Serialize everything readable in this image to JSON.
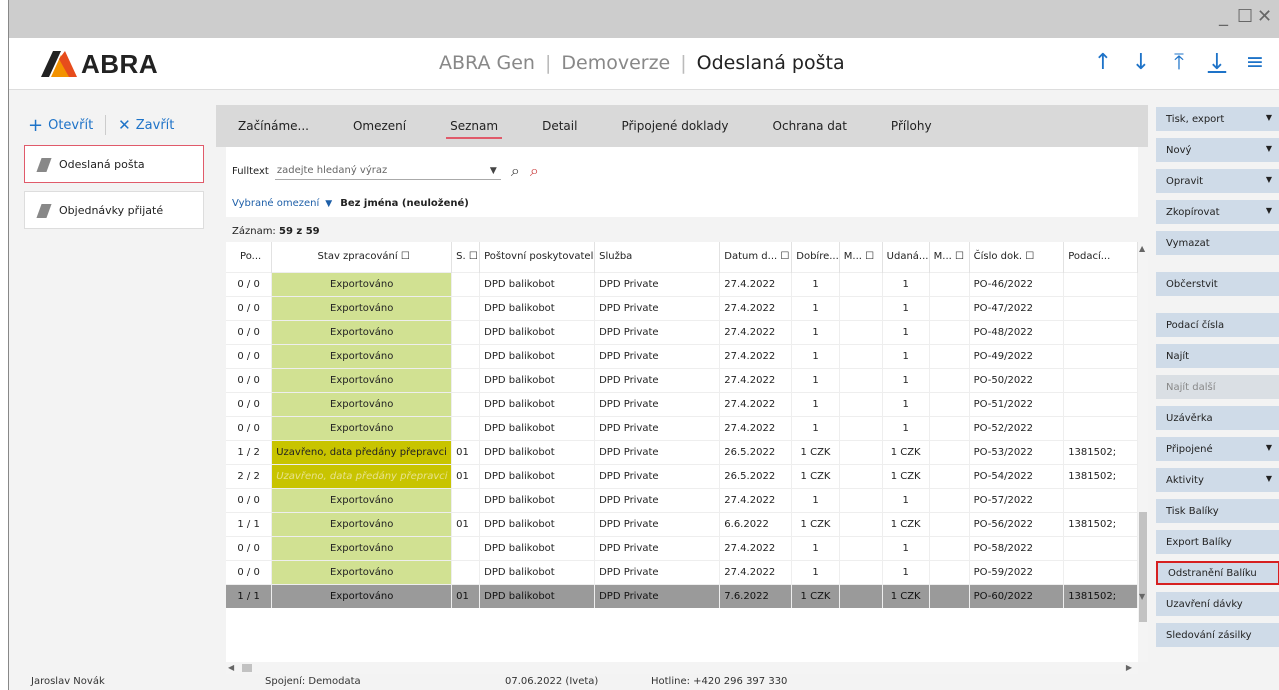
{
  "window": {
    "minimize": "_",
    "maximize": "☐",
    "close": "✕"
  },
  "header": {
    "logo_text": "ABRA",
    "app": "ABRA Gen",
    "mode": "Demoverze",
    "current": "Odeslaná pošta",
    "nav_icons": [
      "arrow-up-icon",
      "arrow-down-icon",
      "arrow-top-icon",
      "arrow-bottom-icon",
      "menu-icon"
    ]
  },
  "left": {
    "open_label": "Otevřít",
    "close_label": "Zavřít",
    "items": [
      {
        "label": "Odeslaná pošta"
      },
      {
        "label": "Objednávky přijaté"
      }
    ]
  },
  "tabs": [
    "Začínáme...",
    "Omezení",
    "Seznam",
    "Detail",
    "Připojené doklady",
    "Ochrana dat",
    "Přílohy"
  ],
  "active_tab": "Seznam",
  "filter": {
    "fulltext_label": "Fulltext",
    "fulltext_placeholder": "zadejte hledaný výraz",
    "omezeni_label": "Vybrané omezení",
    "omezeni_value": "Bez jména (neuložené)"
  },
  "count": {
    "label": "Záznam:",
    "value": "59 z 59"
  },
  "table": {
    "columns": [
      "Po...",
      "Stav zpracování ☐",
      "S. ☐",
      "Poštovní poskytovatel",
      "Služba",
      "Datum d... ☐",
      "Dobíre...",
      "M... ☐",
      "Udaná...",
      "M... ☐",
      "Číslo dok. ☐",
      "Podací..."
    ],
    "rows": [
      [
        "0 / 0",
        "Exportováno",
        "",
        "DPD balikobot",
        "DPD Private",
        "27.4.2022",
        "1",
        "",
        "1",
        "",
        "PO-46/2022",
        ""
      ],
      [
        "0 / 0",
        "Exportováno",
        "",
        "DPD balikobot",
        "DPD Private",
        "27.4.2022",
        "1",
        "",
        "1",
        "",
        "PO-47/2022",
        ""
      ],
      [
        "0 / 0",
        "Exportováno",
        "",
        "DPD balikobot",
        "DPD Private",
        "27.4.2022",
        "1",
        "",
        "1",
        "",
        "PO-48/2022",
        ""
      ],
      [
        "0 / 0",
        "Exportováno",
        "",
        "DPD balikobot",
        "DPD Private",
        "27.4.2022",
        "1",
        "",
        "1",
        "",
        "PO-49/2022",
        ""
      ],
      [
        "0 / 0",
        "Exportováno",
        "",
        "DPD balikobot",
        "DPD Private",
        "27.4.2022",
        "1",
        "",
        "1",
        "",
        "PO-50/2022",
        ""
      ],
      [
        "0 / 0",
        "Exportováno",
        "",
        "DPD balikobot",
        "DPD Private",
        "27.4.2022",
        "1",
        "",
        "1",
        "",
        "PO-51/2022",
        ""
      ],
      [
        "0 / 0",
        "Exportováno",
        "",
        "DPD balikobot",
        "DPD Private",
        "27.4.2022",
        "1",
        "",
        "1",
        "",
        "PO-52/2022",
        ""
      ],
      [
        "1 / 2",
        "Uzavřeno, data předány přepravci",
        "01",
        "DPD balikobot",
        "DPD Private",
        "26.5.2022",
        "1 CZK",
        "",
        "1 CZK",
        "",
        "PO-53/2022",
        "1381502;"
      ],
      [
        "2 / 2",
        "Uzavřeno, data předány přepravci",
        "01",
        "DPD balikobot",
        "DPD Private",
        "26.5.2022",
        "1 CZK",
        "",
        "1 CZK",
        "",
        "PO-54/2022",
        "1381502;"
      ],
      [
        "0 / 0",
        "Exportováno",
        "",
        "DPD balikobot",
        "DPD Private",
        "27.4.2022",
        "1",
        "",
        "1",
        "",
        "PO-57/2022",
        ""
      ],
      [
        "1 / 1",
        "Exportováno",
        "01",
        "DPD balikobot",
        "DPD Private",
        "6.6.2022",
        "1 CZK",
        "",
        "1 CZK",
        "",
        "PO-56/2022",
        "1381502;"
      ],
      [
        "0 / 0",
        "Exportováno",
        "",
        "DPD balikobot",
        "DPD Private",
        "27.4.2022",
        "1",
        "",
        "1",
        "",
        "PO-58/2022",
        ""
      ],
      [
        "0 / 0",
        "Exportováno",
        "",
        "DPD balikobot",
        "DPD Private",
        "27.4.2022",
        "1",
        "",
        "1",
        "",
        "PO-59/2022",
        ""
      ],
      [
        "1 / 1",
        "Exportováno",
        "01",
        "DPD balikobot",
        "DPD Private",
        "7.6.2022",
        "1 CZK",
        "",
        "1 CZK",
        "",
        "PO-60/2022",
        "1381502;"
      ]
    ],
    "row_styles": [
      "green",
      "green",
      "green",
      "green",
      "green",
      "green",
      "green",
      "yellow",
      "yellow-it",
      "green",
      "green",
      "green",
      "green",
      "green"
    ],
    "selected_row": 13
  },
  "right_buttons": [
    {
      "label": "Tisk, export",
      "dropdown": true
    },
    {
      "label": "Nový",
      "dropdown": true
    },
    {
      "label": "Opravit",
      "dropdown": true
    },
    {
      "label": "Zkopírovat",
      "dropdown": true
    },
    {
      "label": "Vymazat"
    },
    {
      "label": "Občerstvit"
    },
    {
      "label": "Podací čísla"
    },
    {
      "label": "Najít"
    },
    {
      "label": "Najít další",
      "disabled": true
    },
    {
      "label": "Uzávěrka"
    },
    {
      "label": "Připojené",
      "dropdown": true
    },
    {
      "label": "Aktivity",
      "dropdown": true
    },
    {
      "label": "Tisk Balíky"
    },
    {
      "label": "Export Balíky"
    },
    {
      "label": "Odstranění Balíku",
      "highlighted": true
    },
    {
      "label": "Uzavření dávky"
    },
    {
      "label": "Sledování zásilky"
    }
  ],
  "status": {
    "user": "Jaroslav Novák",
    "connection": "Spojení: Demodata",
    "date": "07.06.2022 (Iveta)",
    "hotline": "Hotline: +420 296 397 330"
  },
  "colors": {
    "accent": "#1e73c8",
    "tab_underline": "#e05a6a",
    "green": "#d1e192",
    "yellow": "#c8c400",
    "highlight_border": "#d62020"
  }
}
